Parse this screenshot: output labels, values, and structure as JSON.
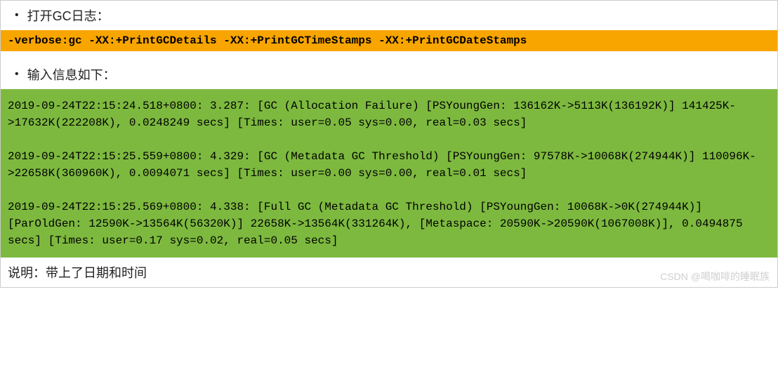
{
  "section1": {
    "bullet_text": "打开GC日志：",
    "code": "-verbose:gc -XX:+PrintGCDetails -XX:+PrintGCTimeStamps -XX:+PrintGCDateStamps"
  },
  "section2": {
    "bullet_text": "输入信息如下：",
    "code": "2019-09-24T22:15:24.518+0800: 3.287: [GC (Allocation Failure) [PSYoungGen: 136162K->5113K(136192K)] 141425K->17632K(222208K), 0.0248249 secs] [Times: user=0.05 sys=0.00, real=0.03 secs]\n\n2019-09-24T22:15:25.559+0800: 4.329: [GC (Metadata GC Threshold) [PSYoungGen: 97578K->10068K(274944K)] 110096K->22658K(360960K), 0.0094071 secs] [Times: user=0.00 sys=0.00, real=0.01 secs]\n\n2019-09-24T22:15:25.569+0800: 4.338: [Full GC (Metadata GC Threshold) [PSYoungGen: 10068K->0K(274944K)] [ParOldGen: 12590K->13564K(56320K)] 22658K->13564K(331264K), [Metaspace: 20590K->20590K(1067008K)], 0.0494875 secs] [Times: user=0.17 sys=0.02, real=0.05 secs]"
  },
  "footer_note": "说明：带上了日期和时间",
  "watermark": "CSDN @喝咖啡的睡眠族"
}
